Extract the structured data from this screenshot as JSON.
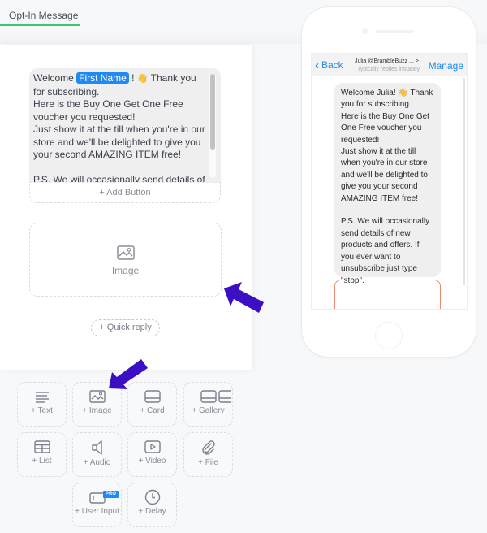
{
  "tab": {
    "label": "Opt-In Message",
    "accent": "#3cc76f"
  },
  "editor": {
    "message": {
      "prefix": "Welcome ",
      "variable_chip": "First Name",
      "after_chip": " ! ",
      "emoji": "👋",
      "body": " Thank you for subscribing.\nHere is the Buy One Get One Free voucher you requested!\nJust show it at the till when you're in our store and we'll be delighted to give you your second AMAZING ITEM free!\n\nP.S. We will occasionally send details of new"
    },
    "add_button_label": "+ Add Button",
    "image_placeholder_label": "Image",
    "quick_reply_label": "+ Quick reply"
  },
  "elements": [
    {
      "label": "+ Text",
      "icon": "text-icon"
    },
    {
      "label": "+ Image",
      "icon": "image-icon"
    },
    {
      "label": "+ Card",
      "icon": "card-icon"
    },
    {
      "label": "+ Gallery",
      "icon": "gallery-icon"
    },
    {
      "label": "+ List",
      "icon": "list-icon"
    },
    {
      "label": "+ Audio",
      "icon": "audio-icon"
    },
    {
      "label": "+ Video",
      "icon": "video-icon"
    },
    {
      "label": "+ File",
      "icon": "paperclip-icon"
    },
    {
      "label": "+ User Input",
      "icon": "user-input-icon",
      "badge": "PRO"
    },
    {
      "label": "+ Delay",
      "icon": "clock-icon"
    }
  ],
  "phone": {
    "back_label": "Back",
    "contact_name": "Julia @BrambleBuzz ... >",
    "contact_status": "Typically replies instantly",
    "manage_label": "Manage",
    "bubble_text": "Welcome Julia! 👋 Thank you for subscribing.\nHere is the Buy One Get One Free voucher you requested!\nJust show it at the till when you're in our store and we'll be delighted to give you your second AMAZING ITEM free!\n\nP.S. We will occasionally send details of new products and offers. If you ever want to unsubscribe just type \"stop\"."
  },
  "colors": {
    "accent_blue": "#1f8af2",
    "annotation_arrow": "#3d0fc4",
    "image_border": "#ee8a72"
  }
}
